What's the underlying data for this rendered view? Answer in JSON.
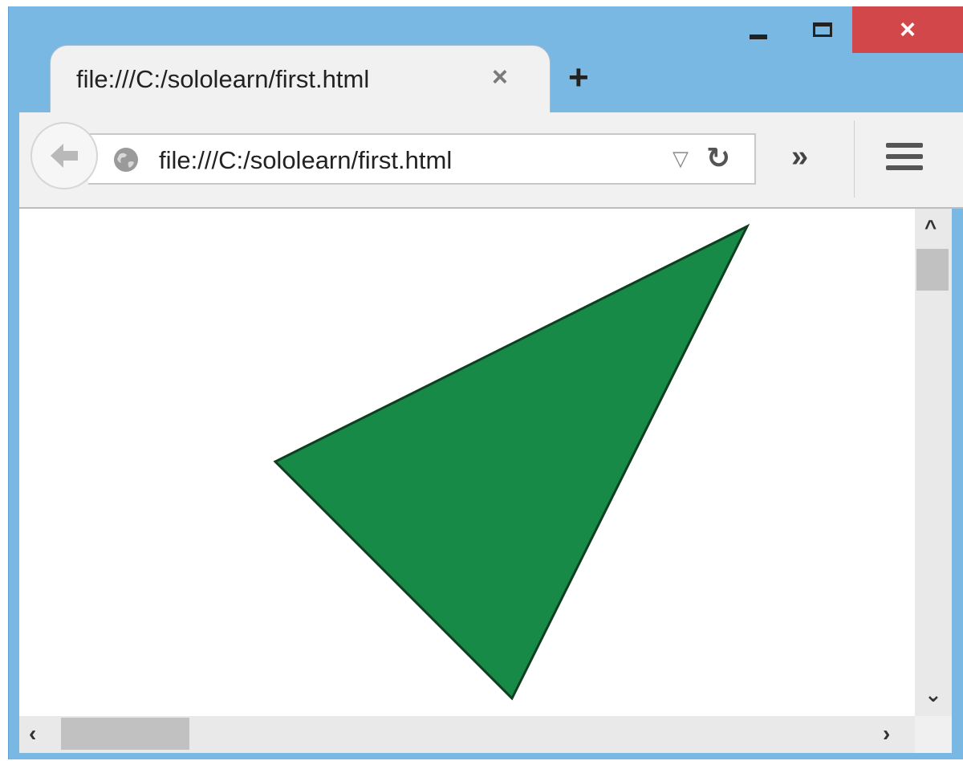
{
  "window": {
    "tab_title": "file:///C:/sololearn/first.html",
    "new_tab_label": "+",
    "close_label": "×"
  },
  "navbar": {
    "url": "file:///C:/sololearn/first.html"
  },
  "icons": {
    "back": "back-arrow-icon",
    "site": "globe-icon",
    "dropdown": "dropdown-triangle-icon",
    "reload": "reload-icon",
    "overflow": "double-chevron-icon",
    "menu": "hamburger-menu-icon"
  },
  "colors": {
    "triangle_fill": "#168a46",
    "triangle_stroke": "#0f3f20",
    "chrome_blue": "#79b8e3",
    "close_red": "#d2484a"
  }
}
